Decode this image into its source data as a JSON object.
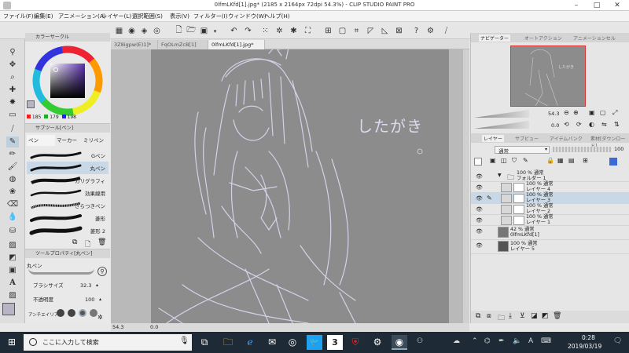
{
  "window": {
    "title": "0lfmLKfd[1].jpg* (2185 x 2164px 72dpi 54.3%)  - CLIP STUDIO PAINT PRO"
  },
  "menu": [
    "ファイル(F)",
    "編集(E)",
    "アニメーション(A)",
    "レイヤー(L)",
    "選択範囲(S)",
    "表示(V)",
    "フィルター(I)",
    "ウィンドウ(W)",
    "ヘルプ(H)"
  ],
  "doc_tabs": [
    "3Z8igpw(E)1]*",
    "FqOLmZcB[1]",
    "0lfmLKfd[1].jpg*"
  ],
  "color_panel": {
    "title": "カラーサークル",
    "r": "185",
    "g": "179",
    "b": "198"
  },
  "subtool_panel": {
    "title": "サブツール[ペン]",
    "tabs": [
      "ペン",
      "マーカー",
      "ミリペン"
    ],
    "brushes": [
      "Gペン",
      "丸ペン",
      "カリグラフィ",
      "効果線用",
      "ざらつきペン",
      "菱形",
      "菱形 2"
    ]
  },
  "tool_property": {
    "title": "ツールプロパティ[丸ペン]",
    "tool_name": "丸ペン",
    "brush_size_label": "ブラシサイズ",
    "brush_size_value": "32.3",
    "opacity_label": "不透明度",
    "opacity_value": "100",
    "antialias_label": "アンチエイリアス"
  },
  "canvas": {
    "handwritten_text": "したがき"
  },
  "status": {
    "zoom": "54.3",
    "angle": "0.0"
  },
  "navigator": {
    "tabs": [
      "ナビゲーター",
      "オートアクション",
      "アニメーションセル"
    ],
    "zoom": "54.3",
    "angle": "0.0"
  },
  "layer_panel": {
    "tabs": [
      "レイヤー",
      "サブビュー",
      "アイテムバンク",
      "素材[ダウンロード]"
    ],
    "blend_mode": "通常",
    "opacity": "100",
    "layers": [
      {
        "line1": "100 % 通常",
        "line2": "フォルダー 1"
      },
      {
        "line1": "100 % 通常",
        "line2": "レイヤー 4"
      },
      {
        "line1": "100 % 通常",
        "line2": "レイヤー 3"
      },
      {
        "line1": "100 % 通常",
        "line2": "レイヤー 2"
      },
      {
        "line1": "100 % 通常",
        "line2": "レイヤー 1"
      },
      {
        "line1": "42 % 通常",
        "line2": "0lfmLKfd[1]"
      },
      {
        "line1": "100 % 通常",
        "line2": "レイヤー 5"
      }
    ]
  },
  "taskbar": {
    "search_placeholder": "ここに入力して検索",
    "time": "0:28",
    "date": "2019/03/19",
    "ime": "A"
  },
  "colors": {
    "current_color": "#b9b3c6",
    "canvas_bg": "#8c8c8c",
    "sketch_line": "#d8d0e8",
    "taskbar_bg": "#1e2a36"
  }
}
